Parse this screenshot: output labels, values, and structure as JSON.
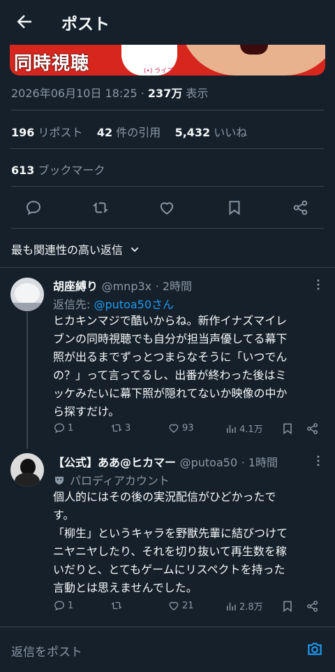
{
  "header": {
    "title": "ポスト"
  },
  "media": {
    "overlay_text": "同時視聴",
    "live_label": "(•) ライブ"
  },
  "post": {
    "timestamp": "2026年06月10日 18:25",
    "separator": "·",
    "views": "237万",
    "views_label": "表示",
    "reposts": "196",
    "reposts_label": "リポスト",
    "quotes": "42",
    "quotes_label": "件の引用",
    "likes": "5,432",
    "likes_label": "いいね",
    "bookmarks": "613",
    "bookmarks_label": "ブックマーク"
  },
  "sort": {
    "label": "最も関連性の高い返信"
  },
  "replies": [
    {
      "name": "胡座縛り",
      "handle": "@mnp3x",
      "time": "· 2時間",
      "reply_to_label": "返信先:",
      "reply_to": "@putoa50さん",
      "lines": [
        "ヒカキンマジで酷いからね。新作イナズマイレ",
        "ブンの同時視聴でも自分が担当声優してる幕下",
        "照が出るまでずっとつまらなそうに「いつでん",
        "の？」って言ってるし、出番が終わった後はミ",
        "ッケみたいに幕下照が隠れてないか映像の中か",
        "ら探すだけ。"
      ],
      "counts": {
        "replies": "1",
        "reposts": "3",
        "likes": "93",
        "views": "4.1万"
      }
    },
    {
      "name": "【公式】ああ@ヒカマー",
      "handle": "@putoa50",
      "time": "· 1時間",
      "badge_label": "パロディアカウント",
      "lines": [
        "個人的にはその後の実況配信がひどかったで",
        "す。",
        "「柳生」というキャラを野獣先輩に結びつけて",
        "ニヤニヤしたり、それを切り抜いて再生数を稼",
        "いだりと、とてもゲームにリスペクトを持った",
        "言動とは思えませんでした。"
      ],
      "counts": {
        "replies": "1",
        "reposts": "",
        "likes": "21",
        "views": "2.8万"
      }
    }
  ],
  "composer": {
    "placeholder": "返信をポスト"
  },
  "colors": {
    "background": "#15202b",
    "text": "#f7f9f9",
    "muted": "#8b98a5",
    "accent": "#1d9bf0",
    "divider": "#38444d"
  }
}
